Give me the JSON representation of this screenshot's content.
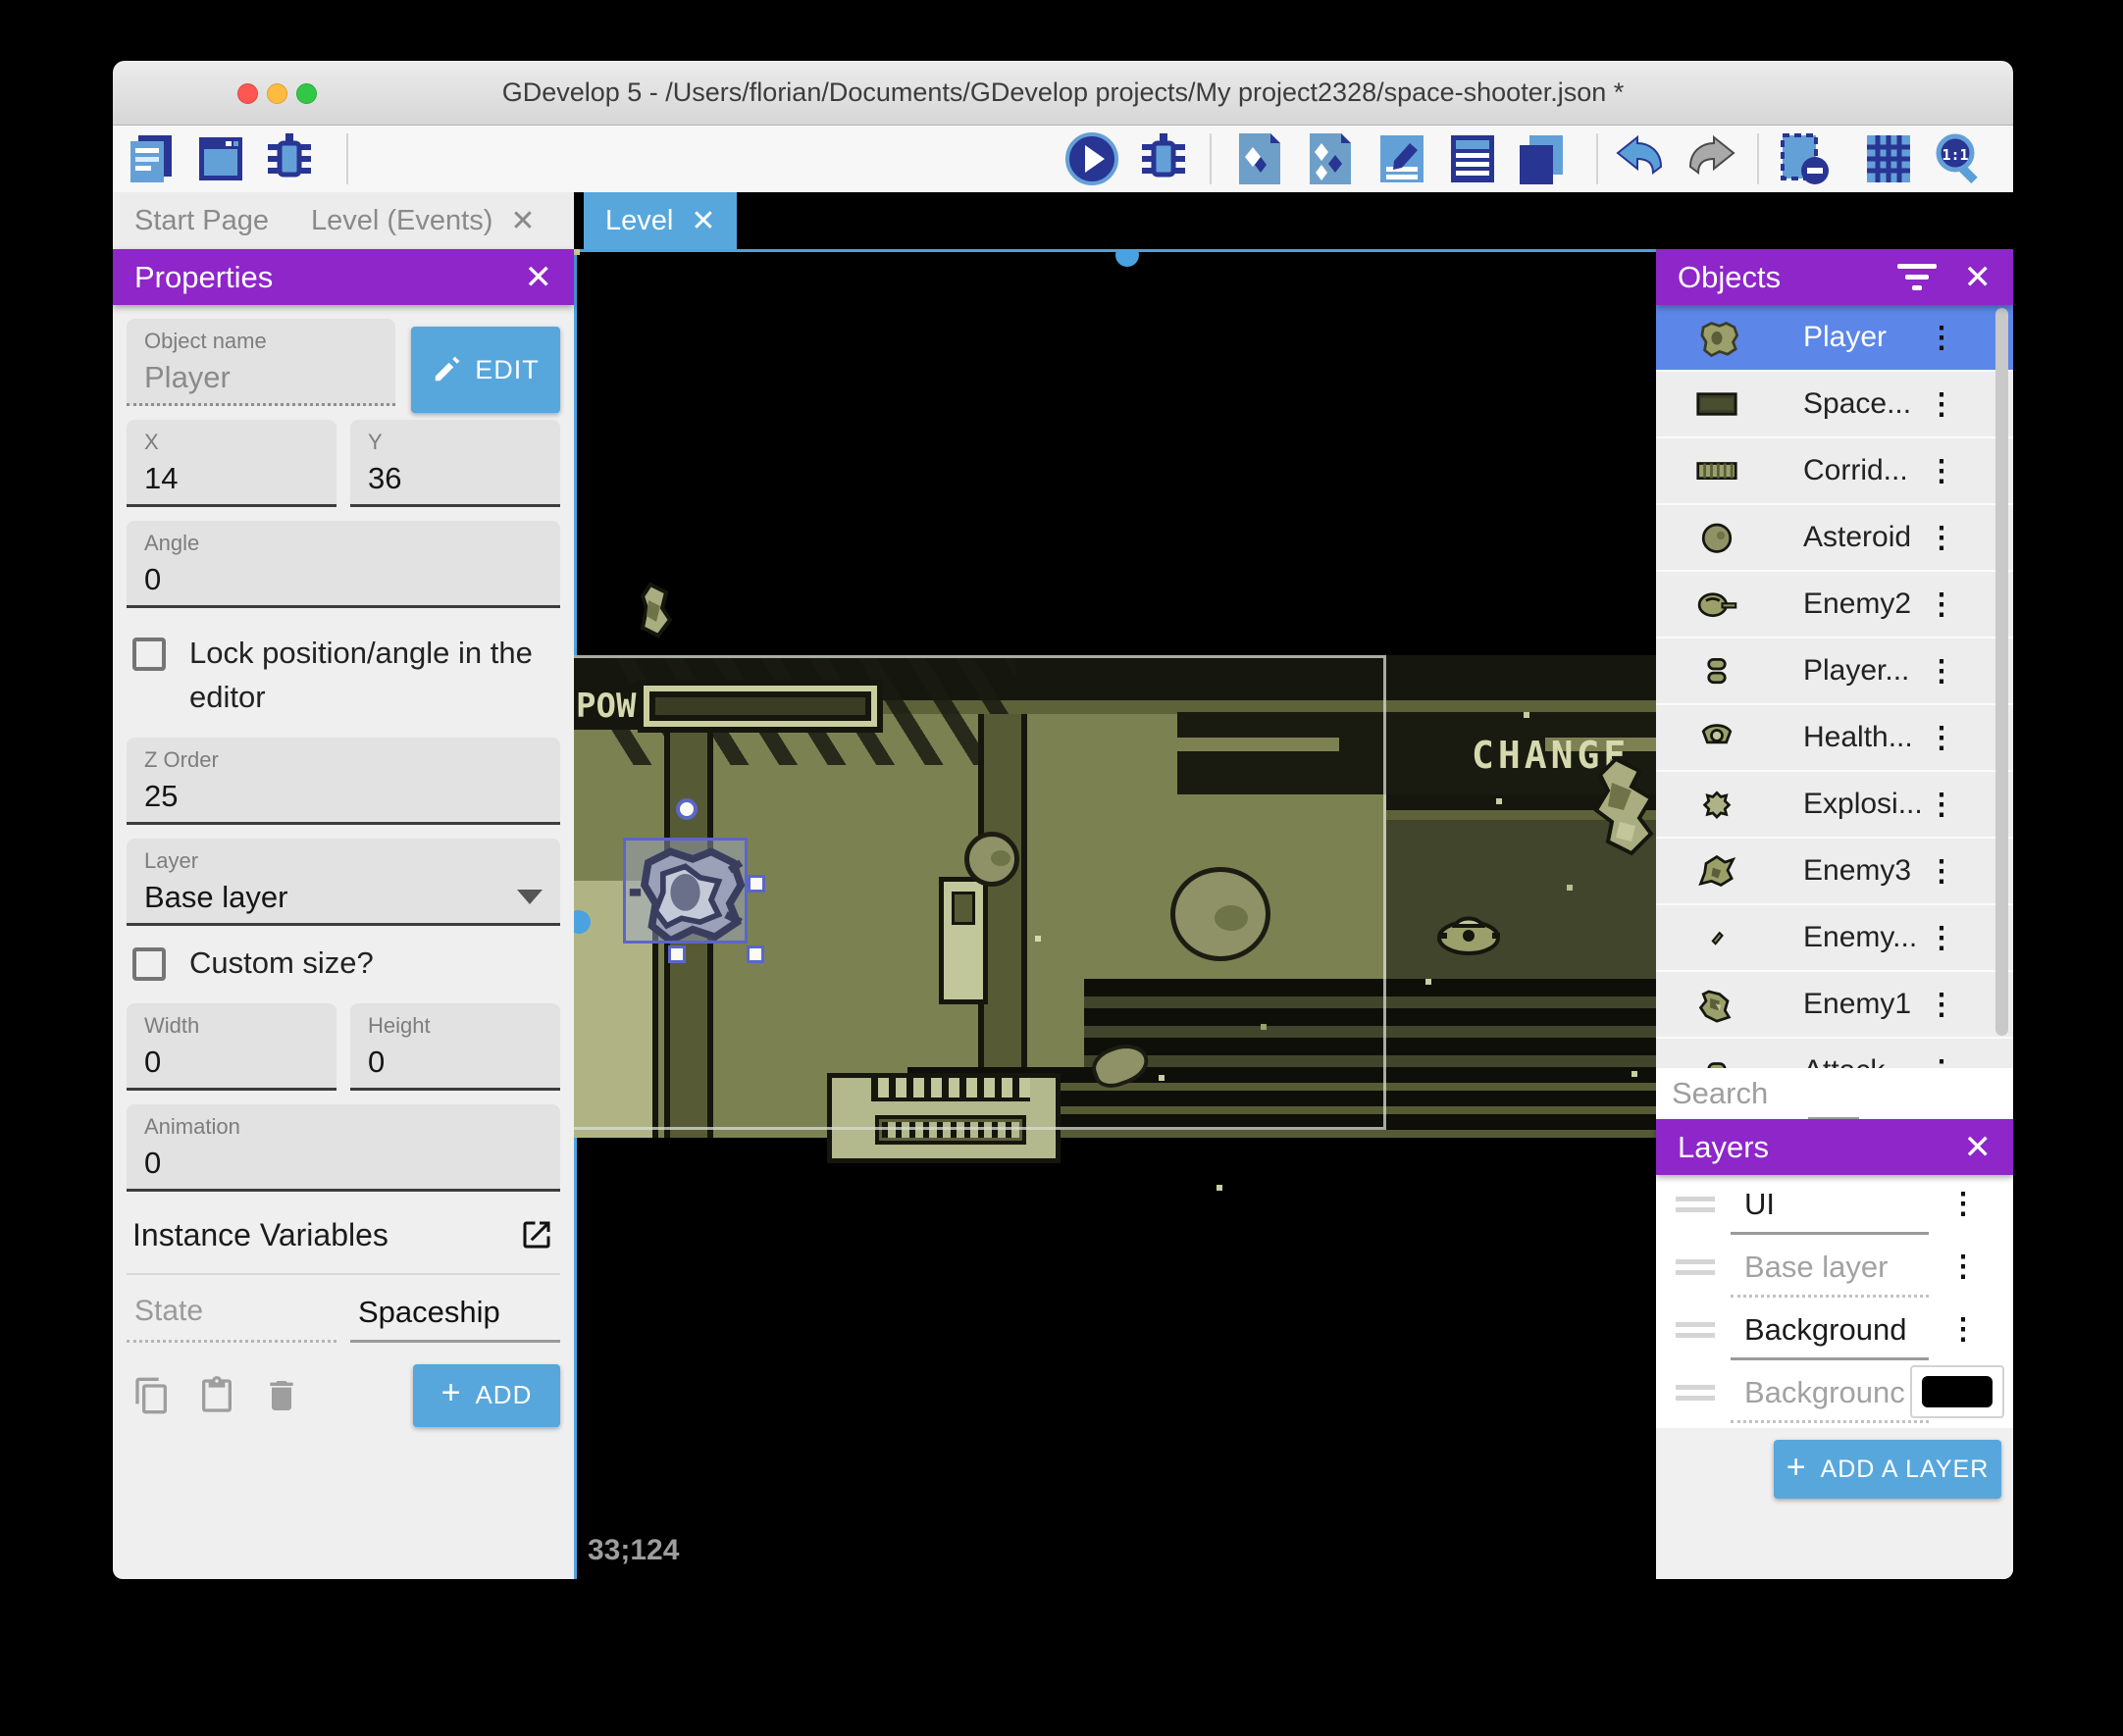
{
  "window": {
    "title": "GDevelop 5 - /Users/florian/Documents/GDevelop projects/My project2328/space-shooter.json *"
  },
  "toolbar": {
    "icons": [
      "project-manager-icon",
      "scene-editor-icon",
      "debugger-icon",
      "play-icon",
      "debug-play-icon",
      "objects-editor-icon",
      "object-groups-icon",
      "properties-pencil-icon",
      "instances-list-icon",
      "layers-stack-icon",
      "undo-icon",
      "redo-icon",
      "delete-selection-icon",
      "grid-icon",
      "zoom-one-to-one-icon"
    ]
  },
  "tabs": {
    "items": [
      {
        "label": "Start Page",
        "active": false
      },
      {
        "label": "Level (Events)",
        "active": false
      },
      {
        "label": "Level",
        "active": true
      }
    ]
  },
  "properties": {
    "title": "Properties",
    "edit_button": "EDIT",
    "object_name": {
      "label": "Object name",
      "value": "Player"
    },
    "fields": {
      "x": {
        "label": "X",
        "value": "14"
      },
      "y": {
        "label": "Y",
        "value": "36"
      },
      "angle": {
        "label": "Angle",
        "value": "0"
      },
      "z_order": {
        "label": "Z Order",
        "value": "25"
      },
      "layer": {
        "label": "Layer",
        "value": "Base layer"
      },
      "width": {
        "label": "Width",
        "value": "0"
      },
      "height": {
        "label": "Height",
        "value": "0"
      },
      "animation": {
        "label": "Animation",
        "value": "0"
      }
    },
    "lock_label": "Lock position/angle in the editor",
    "custom_size_label": "Custom size?",
    "instance_variables_title": "Instance Variables",
    "variables": [
      {
        "name": "State",
        "value": "Spaceship"
      }
    ],
    "add_button": "ADD"
  },
  "canvas": {
    "hud": {
      "pow": "POW",
      "change": "CHANGE"
    },
    "coordinates": "33;124"
  },
  "objects_panel": {
    "title": "Objects",
    "search_placeholder": "Search",
    "items": [
      {
        "label": "Player",
        "selected": true
      },
      {
        "label": "Space..."
      },
      {
        "label": "Corrid..."
      },
      {
        "label": "Asteroid"
      },
      {
        "label": "Enemy2"
      },
      {
        "label": "Player..."
      },
      {
        "label": "Health..."
      },
      {
        "label": "Explosi..."
      },
      {
        "label": "Enemy3"
      },
      {
        "label": "Enemy..."
      },
      {
        "label": "Enemy1"
      },
      {
        "label": "Attack..."
      }
    ]
  },
  "layers_panel": {
    "title": "Layers",
    "items": [
      {
        "label": "UI",
        "muted": false
      },
      {
        "label": "Base layer",
        "muted": true
      },
      {
        "label": "Background",
        "muted": false
      },
      {
        "label": "Backgrounc",
        "muted": true,
        "swatch_color": "#000000"
      }
    ],
    "add_button": "ADD A LAYER"
  },
  "colors": {
    "accent_purple": "#8e26c9",
    "accent_blue": "#57a7dd",
    "selection_row_blue": "#5c87e8",
    "selection_outline": "#5a66c8",
    "game_olive_dark": "#15160d",
    "game_olive_mid": "#7c8152",
    "game_khaki_light": "#c9cda0"
  }
}
